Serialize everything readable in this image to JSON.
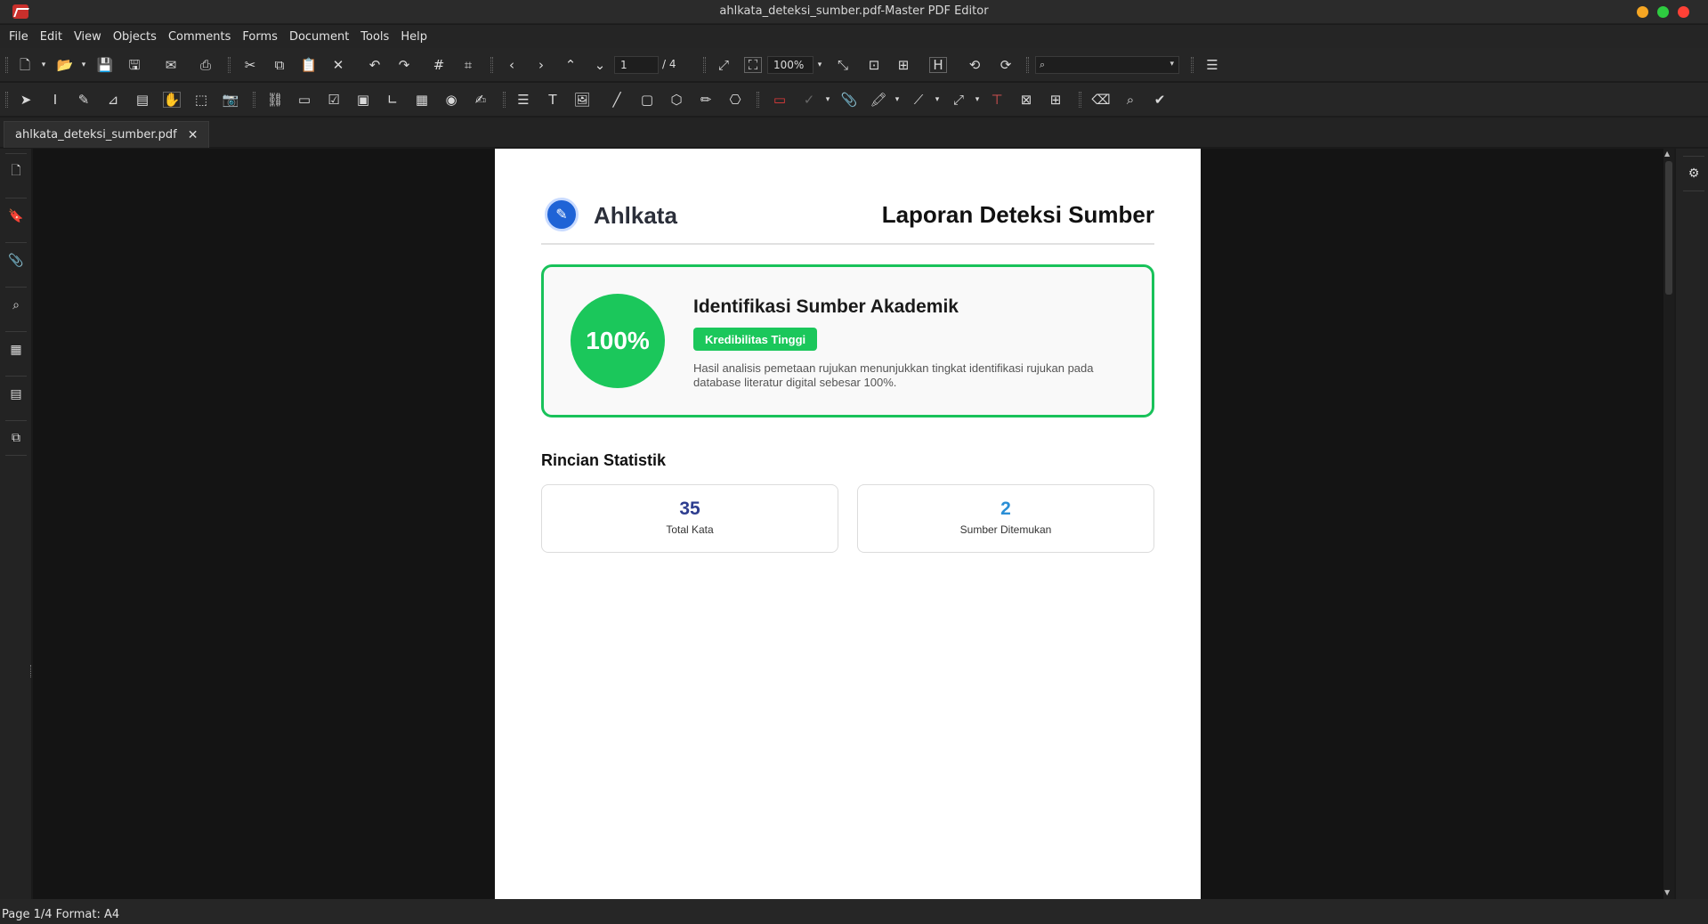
{
  "window": {
    "title": "ahlkata_deteksi_sumber.pdf-Master PDF Editor",
    "controls": {
      "minimize_color": "#f5a623",
      "maximize_color": "#2ecc40",
      "close_color": "#ff4136"
    }
  },
  "menu": [
    "File",
    "Edit",
    "View",
    "Objects",
    "Comments",
    "Forms",
    "Document",
    "Tools",
    "Help"
  ],
  "toolbar": {
    "page_current": "1",
    "page_total": "/ 4",
    "zoom": "100%",
    "search_placeholder": ""
  },
  "tabs": [
    {
      "label": "ahlkata_deteksi_sumber.pdf",
      "close": "✕"
    }
  ],
  "document": {
    "brand": "Ahlkata",
    "report_title": "Laporan Deteksi Sumber",
    "result": {
      "score": "100%",
      "heading": "Identifikasi Sumber Akademik",
      "badge": "Kredibilitas Tinggi",
      "description": "Hasil analisis pemetaan rujukan menunjukkan tingkat identifikasi rujukan pada database literatur digital sebesar 100%."
    },
    "stats_title": "Rincian Statistik",
    "stats": [
      {
        "value": "35",
        "label": "Total Kata",
        "color": "#2d3d8f"
      },
      {
        "value": "2",
        "label": "Sumber Ditemukan",
        "color": "#2b8fd6"
      }
    ],
    "accent_color": "#1bc75b"
  },
  "status": {
    "text": "Page 1/4 Format: A4"
  },
  "icons": {
    "toolbar1": [
      "new-document-icon",
      "open-folder-icon",
      "save-icon",
      "save-as-icon",
      "email-icon",
      "print-icon",
      "cut-icon",
      "copy-icon",
      "paste-icon",
      "delete-icon",
      "undo-icon",
      "redo-icon",
      "grid-icon",
      "snap-grid-icon",
      "previous-page-icon",
      "next-page-icon",
      "first-page-icon",
      "last-page-icon",
      "fit-page-icon",
      "actual-size-icon",
      "fit-width-icon",
      "fit-visible-icon",
      "full-screen-icon",
      "rotate-ccw-icon",
      "rotate-cw-icon",
      "search-icon",
      "menu-icon"
    ],
    "toolbar2": [
      "select-icon",
      "text-select-icon",
      "edit-text-icon",
      "edit-object-icon",
      "form-icon",
      "hand-icon",
      "marquee-icon",
      "snapshot-icon",
      "link-icon",
      "button-field-icon",
      "checkbox-icon",
      "combobox-icon",
      "list-icon",
      "text-field-icon",
      "radio-icon",
      "signature-field-icon",
      "insert-text-icon",
      "typewriter-icon",
      "image-icon",
      "line-icon",
      "rectangle-icon",
      "polygon-icon",
      "pencil-icon",
      "stamp-icon",
      "comment-box-icon",
      "check-mark-icon",
      "attach-icon",
      "highlighter-icon",
      "measure-line-icon",
      "arrow-icon",
      "text-box-icon",
      "zoom-area-icon",
      "arrange-icon",
      "eraser-icon",
      "magnifier-icon",
      "approve-icon"
    ],
    "sidebar": [
      "pages-icon",
      "bookmark-icon",
      "attachment-icon",
      "search-icon",
      "layers-icon",
      "forms-icon",
      "copy-pages-icon"
    ]
  }
}
